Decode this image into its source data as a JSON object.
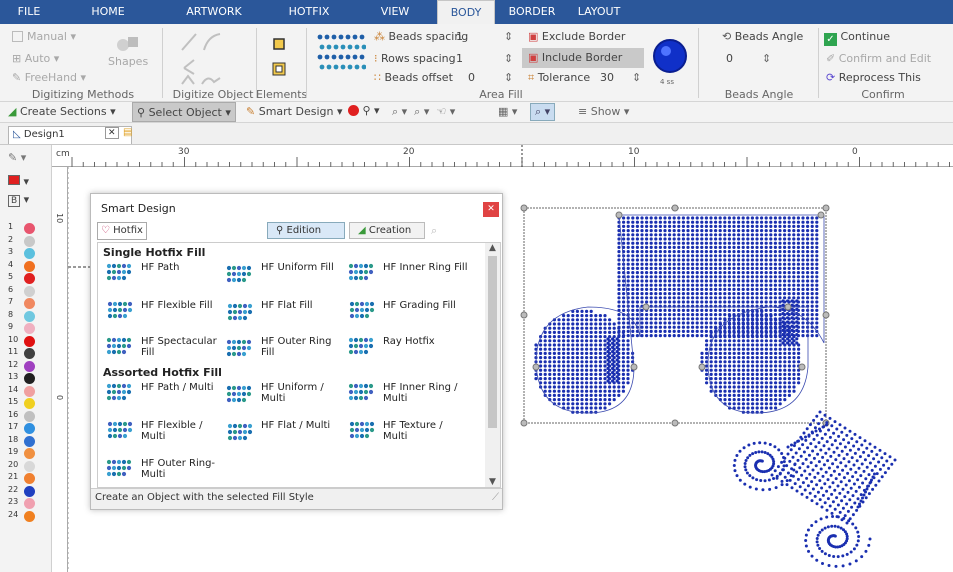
{
  "menu": {
    "tabs": [
      "FILE",
      "HOME",
      "ARTWORK",
      "HOTFIX",
      "VIEW",
      "BODY",
      "BORDER",
      "LAYOUT"
    ],
    "active": "BODY"
  },
  "ribbon": {
    "digitizing": {
      "label": "Digitizing Methods",
      "manual": "Manual",
      "auto": "Auto",
      "freehand": "FreeHand",
      "shapes": "Shapes"
    },
    "digitize_object": {
      "label": "Digitize Object"
    },
    "elements": {
      "label": "Elements"
    },
    "area_fill": {
      "label": "Area Fill",
      "beads_spacing_label": "Beads spacing",
      "beads_spacing": "1",
      "rows_spacing_label": "Rows spacing",
      "rows_spacing": "1",
      "beads_offset_label": "Beads offset",
      "beads_offset": "0",
      "exclude_border": "Exclude Border",
      "include_border": "Include Border",
      "tolerance_label": "Tolerance",
      "tolerance": "30",
      "bead_size": "4 ss"
    },
    "beads_angle": {
      "label": "Beads Angle",
      "title": "Beads Angle",
      "value": "0"
    },
    "confirm": {
      "label": "Confirm",
      "continue": "Continue",
      "confirm_edit": "Confirm and Edit",
      "reprocess": "Reprocess This"
    }
  },
  "toolbar2": {
    "create_sections": "Create Sections",
    "select_object": "Select Object",
    "smart_design": "Smart Design",
    "show": "Show"
  },
  "doc_tab": {
    "name": "Design1"
  },
  "ruler": {
    "unit": "cm",
    "top_labels": [
      "30",
      "20",
      "10",
      "0"
    ],
    "left_labels": [
      "10",
      "0"
    ]
  },
  "left": {
    "b_label": "B"
  },
  "colors": [
    {
      "n": "1",
      "c": "#e8556e"
    },
    {
      "n": "2",
      "c": "#c8c8c8"
    },
    {
      "n": "3",
      "c": "#5bc0de"
    },
    {
      "n": "4",
      "c": "#f07020"
    },
    {
      "n": "5",
      "c": "#e02020"
    },
    {
      "n": "6",
      "c": "#d0d0d0"
    },
    {
      "n": "7",
      "c": "#f08860"
    },
    {
      "n": "8",
      "c": "#70c8e0"
    },
    {
      "n": "9",
      "c": "#f0b0c0"
    },
    {
      "n": "10",
      "c": "#e01010"
    },
    {
      "n": "11",
      "c": "#404040"
    },
    {
      "n": "12",
      "c": "#a040c0"
    },
    {
      "n": "13",
      "c": "#202020"
    },
    {
      "n": "14",
      "c": "#f0a0a0"
    },
    {
      "n": "15",
      "c": "#f0d020"
    },
    {
      "n": "16",
      "c": "#c0c0c0"
    },
    {
      "n": "17",
      "c": "#3090e0"
    },
    {
      "n": "18",
      "c": "#3070d0"
    },
    {
      "n": "19",
      "c": "#f09040"
    },
    {
      "n": "20",
      "c": "#d8d8d8"
    },
    {
      "n": "21",
      "c": "#f08030"
    },
    {
      "n": "22",
      "c": "#2040c0"
    },
    {
      "n": "23",
      "c": "#f0a0b0"
    },
    {
      "n": "24",
      "c": "#f08020"
    }
  ],
  "dialog": {
    "title": "Smart Design",
    "hotfix_tab": "Hotfix",
    "edition": "Edition",
    "creation": "Creation",
    "single_header": "Single Hotfix Fill",
    "assorted_header": "Assorted Hotfix Fill",
    "single": [
      "HF Path",
      "HF Uniform Fill",
      "HF Inner Ring Fill",
      "HF Flexible Fill",
      "HF Flat Fill",
      "HF Grading Fill",
      "HF Spectacular Fill",
      "HF Outer Ring Fill",
      "Ray Hotfix"
    ],
    "assorted": [
      "HF Path / Multi",
      "HF Uniform / Multi",
      "HF Inner Ring / Multi",
      "HF Flexible / Multi",
      "HF Flat / Multi",
      "HF Texture / Multi",
      "HF Outer Ring-Multi"
    ],
    "status": "Create an Object with the selected Fill Style"
  },
  "accent": "#2b579a",
  "bead_color": "#1a2fb0"
}
